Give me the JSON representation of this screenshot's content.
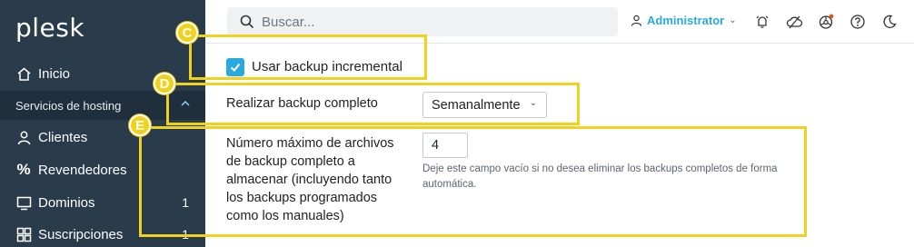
{
  "app": {
    "logo": "plesk",
    "colors": {
      "sidebar": "#2a3b4b",
      "accent": "#28aade",
      "annotation": "#f0d21e"
    }
  },
  "sidebar": {
    "items": [
      {
        "label": "Inicio",
        "icon": "home-icon"
      },
      {
        "label": "Clientes",
        "icon": "user-icon"
      },
      {
        "label": "Revendedores",
        "icon": "percent-icon"
      },
      {
        "label": "Dominios",
        "icon": "monitor-icon",
        "count": "1"
      },
      {
        "label": "Suscripciones",
        "icon": "grid-icon",
        "count": "1"
      }
    ],
    "section": {
      "label": "Servicios de hosting",
      "icon": "chevron-up-icon"
    }
  },
  "header": {
    "search_placeholder": "Buscar...",
    "user": "Administrator",
    "icons": [
      "user-icon",
      "notifications-icon",
      "cloud-icon",
      "extensions-icon",
      "help-icon",
      "moon-icon"
    ]
  },
  "form": {
    "incremental_label": "Usar backup incremental",
    "incremental_checked": true,
    "full_backup_label": "Realizar backup completo",
    "full_backup_value": "Semanalmente",
    "max_backups_label": "Número máximo de archivos de backup completo a almacenar (incluyendo tanto los backups programados como los manuales)",
    "max_backups_value": "4",
    "max_backups_hint": "Deje este campo vacío si no desea eliminar los backups completos de forma automática."
  },
  "annotations": {
    "c": "C",
    "d": "D",
    "e": "E"
  }
}
